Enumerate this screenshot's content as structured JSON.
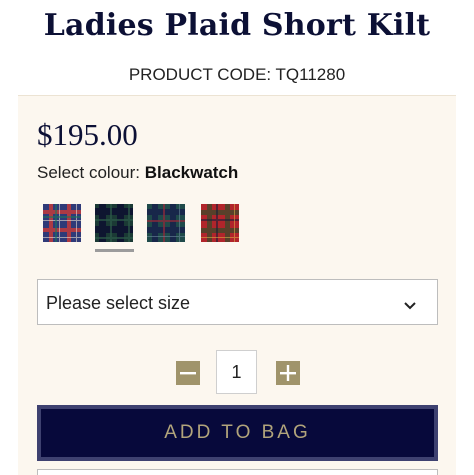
{
  "product": {
    "title": "Ladies Plaid Short Kilt",
    "code": "PRODUCT CODE: TQ11280",
    "price": "$195.00"
  },
  "colour": {
    "label": "Select colour:",
    "selected": "Blackwatch",
    "swatches": [
      {
        "name": "red-blue-tartan",
        "base": "#2f3a78",
        "stripe": "#c23b3b"
      },
      {
        "name": "blackwatch",
        "base": "#1b3a35",
        "stripe": "#0d1230"
      },
      {
        "name": "green-navy-tartan",
        "base": "#1f4a4a",
        "stripe": "#6a2535"
      },
      {
        "name": "royal-red-tartan",
        "base": "#b1252b",
        "stripe": "#3b4a2a"
      }
    ],
    "selected_index": 1
  },
  "size": {
    "placeholder": "Please select size"
  },
  "quantity": {
    "value": "1"
  },
  "actions": {
    "add_to_bag": "ADD TO BAG"
  },
  "colors": {
    "navy": "#07093b",
    "gold": "#b1a47b",
    "panel": "#fcf7ef"
  },
  "icons": {
    "minus": "minus-icon",
    "plus": "plus-icon",
    "chevron": "chevron-down-icon"
  }
}
